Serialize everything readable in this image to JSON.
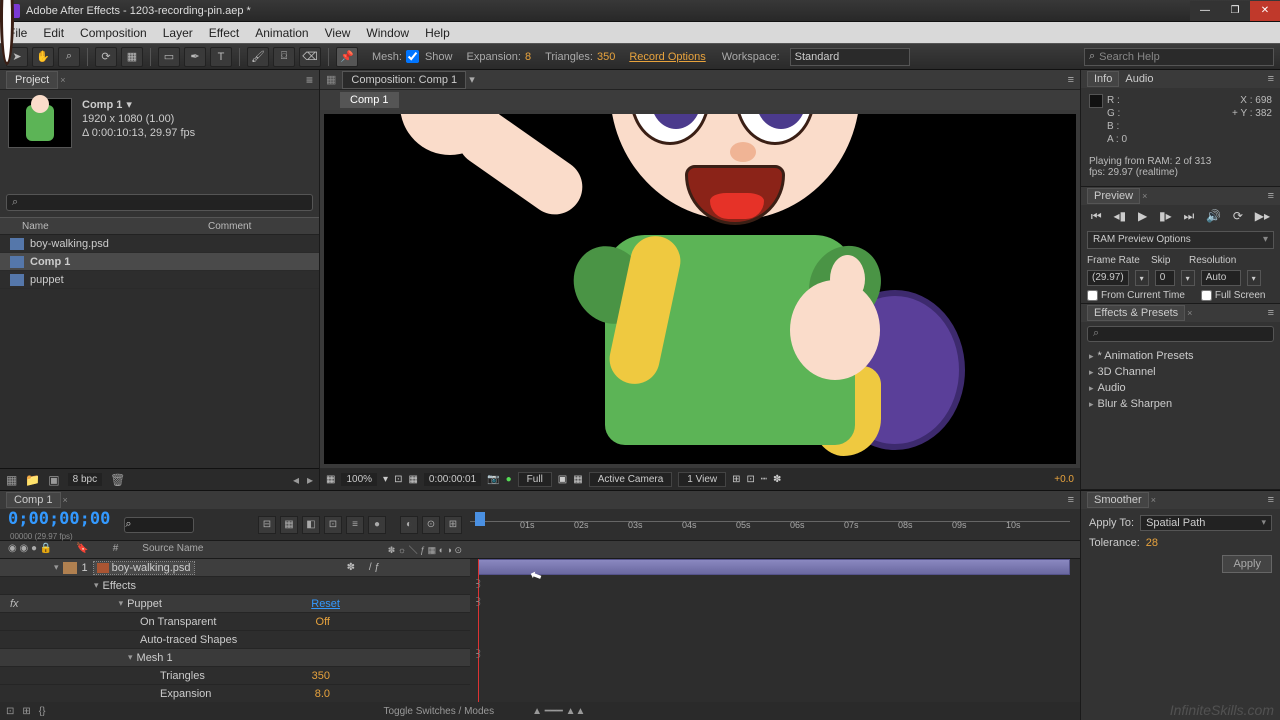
{
  "title": "Adobe After Effects - 1203-recording-pin.aep *",
  "menu": [
    "File",
    "Edit",
    "Composition",
    "Layer",
    "Effect",
    "Animation",
    "View",
    "Window",
    "Help"
  ],
  "toolbar": {
    "mesh": "Mesh:",
    "show": "Show",
    "expansion_l": "Expansion:",
    "expansion_v": "8",
    "tri_l": "Triangles:",
    "tri_v": "350",
    "record": "Record Options",
    "workspace_l": "Workspace:",
    "workspace": "Standard",
    "search": "Search Help"
  },
  "project": {
    "tab": "Project",
    "compName": "Comp 1",
    "dims": "1920 x 1080 (1.00)",
    "dur": "Δ 0:00:10:13, 29.97 fps",
    "col_name": "Name",
    "col_comment": "Comment",
    "items": [
      "boy-walking.psd",
      "Comp 1",
      "puppet"
    ],
    "bpc": "8 bpc"
  },
  "comp": {
    "bread": "Composition: Comp 1",
    "tab": "Comp 1",
    "zoom": "100%",
    "time": "0:00:00:01",
    "res": "Full",
    "view1": "Active Camera",
    "view2": "1 View",
    "exp": "+0.0"
  },
  "info": {
    "tab1": "Info",
    "tab2": "Audio",
    "r": "R :",
    "g": "G :",
    "b": "B :",
    "a": "A :  0",
    "x": "X : 698",
    "y": "Y : 382",
    "playing1": "Playing from RAM: 2 of 313",
    "playing2": "fps: 29.97 (realtime)"
  },
  "preview": {
    "tab": "Preview",
    "ram": "RAM Preview Options",
    "fr_l": "Frame Rate",
    "fr": "(29.97)",
    "skip_l": "Skip",
    "skip": "0",
    "res_l": "Resolution",
    "res": "Auto",
    "chk1": "From Current Time",
    "chk2": "Full Screen"
  },
  "effects": {
    "tab": "Effects & Presets",
    "items": [
      "* Animation Presets",
      "3D Channel",
      "Audio",
      "Blur & Sharpen"
    ]
  },
  "smoother": {
    "tab": "Smoother",
    "apply_l": "Apply To:",
    "apply": "Spatial Path",
    "tol_l": "Tolerance:",
    "tol": "28",
    "btn": "Apply"
  },
  "timeline": {
    "tab": "Comp 1",
    "tc": "0;00;00;00",
    "tcfine": "00000 (29.97 fps)",
    "col_src": "Source Name",
    "layer": "boy-walking.psd",
    "effects": "Effects",
    "puppet": "Puppet",
    "reset": "Reset",
    "ontransp": "On Transparent",
    "off": "Off",
    "autoshape": "Auto-traced Shapes",
    "mesh1": "Mesh 1",
    "tri_l": "Triangles",
    "tri": "350",
    "exp_l": "Expansion",
    "exp": "8.0",
    "toggle": "Toggle Switches / Modes",
    "ticks": [
      "01s",
      "02s",
      "03s",
      "04s",
      "05s",
      "06s",
      "07s",
      "08s",
      "09s",
      "10s"
    ]
  },
  "watermark": "InfiniteSkills.com"
}
